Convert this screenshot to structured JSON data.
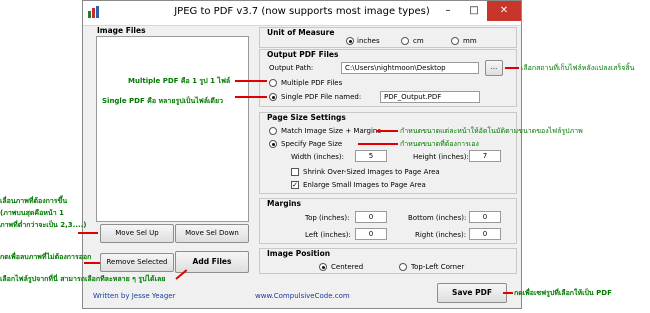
{
  "window": {
    "title": "JPEG to PDF  v3.7   (now supports most image types)",
    "controls": [
      "–",
      "□",
      "✕"
    ],
    "close_color": "#c8352b"
  },
  "image_files": {
    "label": "Image Files"
  },
  "unit_of_measure": {
    "label": "Unit of Measure",
    "options": [
      "inches",
      "cm",
      "mm"
    ],
    "selected": "inches"
  },
  "output_pdf": {
    "label": "Output PDF Files",
    "path_label": "Output Path:",
    "path_value": "C:\\Users\\nightmoon\\Desktop",
    "browse_label": "...",
    "multiple_label": "Multiple PDF Files",
    "single_label": "Single PDF File named:",
    "single_value": "PDF_Output.PDF"
  },
  "page_size": {
    "label": "Page Size Settings",
    "match_label": "Match Image Size + Margins",
    "specify_label": "Specify Page Size",
    "width_label": "Width (inches):",
    "width_value": "5",
    "height_label": "Height (inches):",
    "height_value": "7",
    "shrink_label": "Shrink Over-Sized Images to Page Area",
    "enlarge_label": "Enlarge Small Images to Page Area",
    "check_glyph": "✓"
  },
  "margins": {
    "label": "Margins",
    "top_label": "Top (inches):",
    "top_value": "0",
    "bottom_label": "Bottom (inches):",
    "bottom_value": "0",
    "left_label": "Left (inches):",
    "left_value": "0",
    "right_label": "Right (inches):",
    "right_value": "0"
  },
  "image_position": {
    "label": "Image Position",
    "centered_label": "Centered",
    "topleft_label": "Top-Left Corner"
  },
  "buttons": {
    "move_up": "Move Sel Up",
    "move_down": "Move Sel Down",
    "remove": "Remove Selected",
    "add": "Add Files",
    "save": "Save PDF"
  },
  "footer": {
    "author": "Written by Jesse Yeager",
    "website": "www.CompulsiveCode.com"
  },
  "annotations": {
    "multiple_pdf": "Multiple PDF คือ 1 รูป 1 ไฟล์",
    "single_pdf": "Single PDF คือ หลายรูปเป็นไฟล์เดียว",
    "browse": "เลือกสถานที่เก็บไฟล์หลังแปลงเสร็จสิ้น",
    "match_size": "กำหนดขนาดแต่ละหน้าให้อัตโนมัติตามขนาดของไฟล์รูปภาพ",
    "specify_size": "กำหนดขนาดที่ต้องการเอง",
    "move_line1": "เลื่อนภาพที่ต้องการขึ้น",
    "move_line2": "(ภาพบนสุดคือหน้า 1",
    "move_line3": "ภาพที่ต่ำกว่าจะเป็น 2,3....)",
    "remove": "กดเพื่อลบภาพที่ไม่ต้องการออก",
    "add": "เลือกไฟล์รูปจากที่นี่ สามารถเลือกทีละหลาย ๆ รูปได้เลย",
    "save": "กดเพื่อเซฟรูปที่เลือกให้เป็น PDF",
    "text_color": "#007a00",
    "arrow_color": "#e00000"
  }
}
